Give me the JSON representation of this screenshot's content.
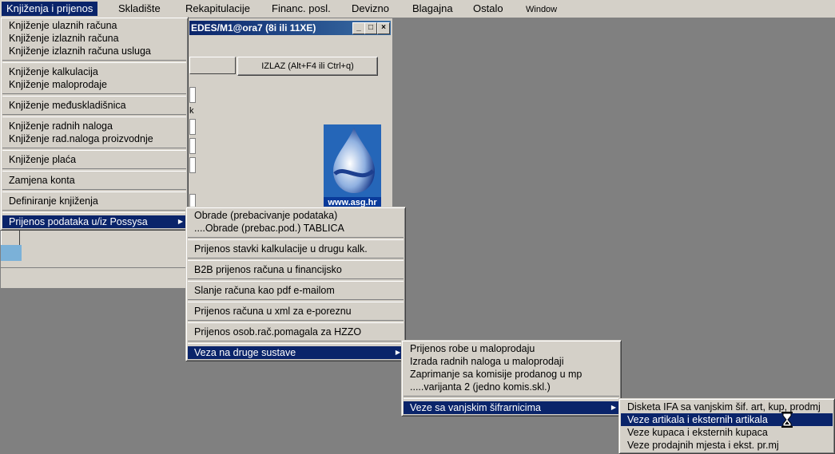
{
  "menubar": {
    "items": [
      {
        "label": "Knjiženja i prijenos",
        "id": "knjizenja"
      },
      {
        "label": "Skladište",
        "id": "skladiste"
      },
      {
        "label": "Rekapitulacije",
        "id": "rekapitulacije"
      },
      {
        "label": "Financ. posl.",
        "id": "financ"
      },
      {
        "label": "Devizno",
        "id": "devizno"
      },
      {
        "label": "Blagajna",
        "id": "blagajna"
      },
      {
        "label": "Ostalo",
        "id": "ostalo"
      },
      {
        "label": "Window",
        "id": "window"
      }
    ]
  },
  "bg_window": {
    "title": "EDES/M1@ora7 (8i ili 11XE)",
    "exit_label": "IZLAZ (Alt+F4 ili Ctrl+q)",
    "logo_url": "www.asg.hr",
    "label_k": "k"
  },
  "menu1": [
    {
      "label": "Knjiženje ulaznih računa"
    },
    {
      "label": "Knjiženje izlaznih računa"
    },
    {
      "label": "Knjiženje izlaznih računa usluga"
    },
    {
      "sep": true
    },
    {
      "label": "Knjiženje kalkulacija"
    },
    {
      "label": "Knjiženje maloprodaje"
    },
    {
      "sep": true
    },
    {
      "label": "Knjiženje međuskladišnica"
    },
    {
      "sep": true
    },
    {
      "label": "Knjiženje radnih naloga"
    },
    {
      "label": "Knjiženje rad.naloga proizvodnje"
    },
    {
      "sep": true
    },
    {
      "label": "Knjiženje plaća"
    },
    {
      "sep": true
    },
    {
      "label": "Zamjena konta"
    },
    {
      "sep": true
    },
    {
      "label": "Definiranje knjiženja"
    },
    {
      "sep": true
    },
    {
      "label": "Prijenos podataka u/iz Possysa",
      "submenu": true,
      "selected": true
    }
  ],
  "menu2": [
    {
      "label": "Obrade (prebacivanje podataka)"
    },
    {
      "label": "....Obrade (prebac.pod.) TABLICA"
    },
    {
      "sep": true
    },
    {
      "label": "Prijenos stavki kalkulacije u drugu kalk."
    },
    {
      "sep": true
    },
    {
      "label": "B2B prijenos računa u financijsko"
    },
    {
      "sep": true
    },
    {
      "label": "Slanje računa kao pdf e-mailom"
    },
    {
      "sep": true
    },
    {
      "label": "Prijenos računa u xml za e-poreznu"
    },
    {
      "sep": true
    },
    {
      "label": "Prijenos osob.rač.pomagala za HZZO"
    },
    {
      "sep": true
    },
    {
      "label": "Veza na druge sustave",
      "submenu": true,
      "selected": true
    }
  ],
  "menu3": [
    {
      "label": "Prijenos robe u maloprodaju"
    },
    {
      "label": "Izrada radnih naloga u maloprodaji"
    },
    {
      "label": "Zaprimanje sa komisije prodanog u mp"
    },
    {
      "label": ".....varijanta 2 (jedno komis.skl.)"
    },
    {
      "sep": true
    },
    {
      "label": "Veze sa vanjskim šifrarnicima",
      "submenu": true,
      "selected": true
    }
  ],
  "menu4": [
    {
      "label": "Disketa IFA sa vanjskim šif. art, kup, prodmj"
    },
    {
      "label": "Veze artikala i eksternih artikala",
      "selected": true
    },
    {
      "label": "Veze kupaca i eksternih kupaca"
    },
    {
      "label": "Veze prodajnih mjesta i ekst. pr.mj"
    }
  ]
}
